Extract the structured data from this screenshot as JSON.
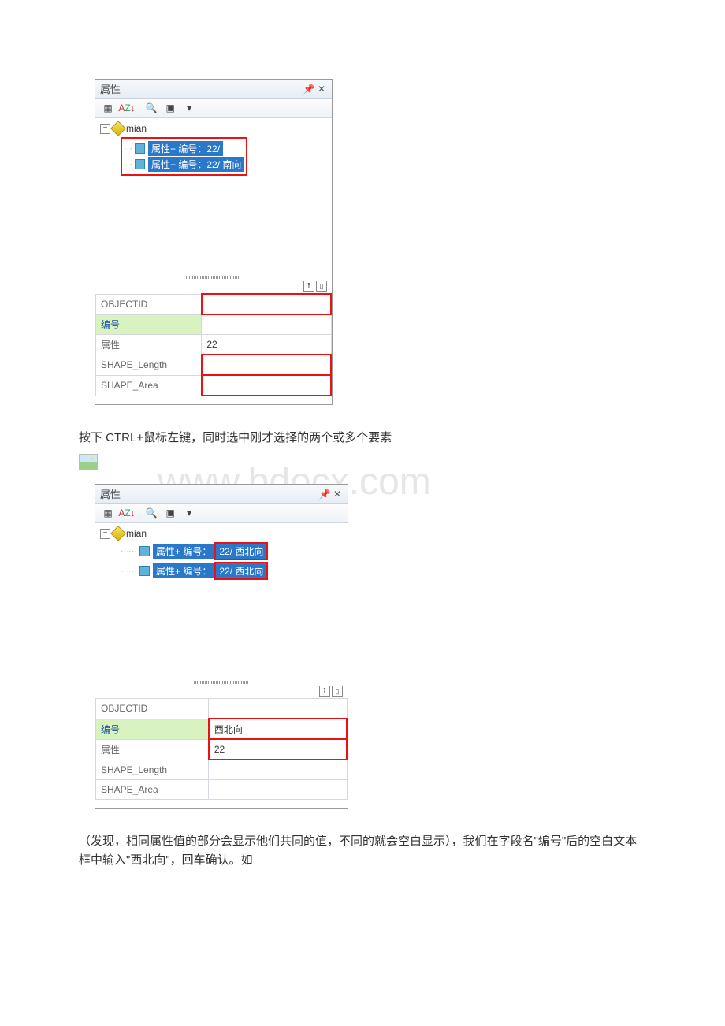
{
  "panel1": {
    "title": "属性",
    "root": "mian",
    "item1": "属性+ 编号：22/",
    "item2": "属性+ 编号：22/ 南向",
    "rows": {
      "r1": "OBJECTID",
      "r2": "编号",
      "r3": "属性",
      "r3v": "22",
      "r4": "SHAPE_Length",
      "r5": "SHAPE_Area"
    }
  },
  "para1": "按下 CTRL+鼠标左键，同时选中刚才选择的两个或多个要素",
  "watermark": "www.bdocx.com",
  "panel2": {
    "title": "属性",
    "root": "mian",
    "item_left": "属性+ 编号：",
    "item_right": "22/ 西北向",
    "rows": {
      "r1": "OBJECTID",
      "r2": "编号",
      "r2v": "西北向",
      "r3": "属性",
      "r3v": "22",
      "r4": "SHAPE_Length",
      "r5": "SHAPE_Area"
    }
  },
  "para2": "（发现，相同属性值的部分会显示他们共同的值，不同的就会空白显示），我们在字段名\"编号\"后的空白文本框中输入\"西北向\"，回车确认。如"
}
